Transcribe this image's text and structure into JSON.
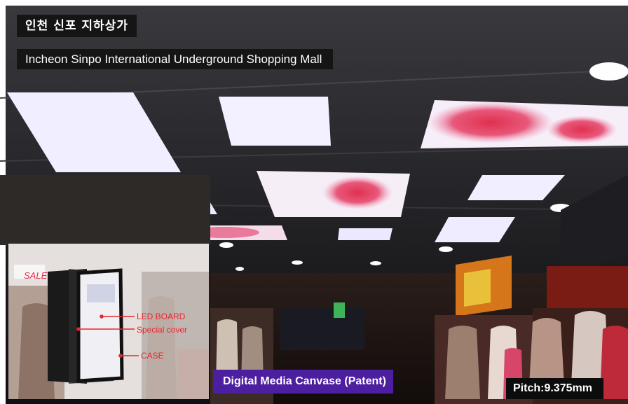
{
  "title_korean": "인천 신포 지하상가",
  "title_english": "Incheon Sinpo International Underground Shopping Mall",
  "inset": {
    "callouts": [
      "LED BOARD",
      "Special cover",
      "CASE"
    ],
    "sign_text": "SALE"
  },
  "badge_text": "Digital Media Canvase (Patent)",
  "pitch_text": "Pitch:9.375mm",
  "colors": {
    "label_background": "#151515",
    "badge_background": "#4c1ea0",
    "callout_red": "#e8262c",
    "panel_pink": "#e0446a",
    "panel_white": "#f2f0ff"
  }
}
